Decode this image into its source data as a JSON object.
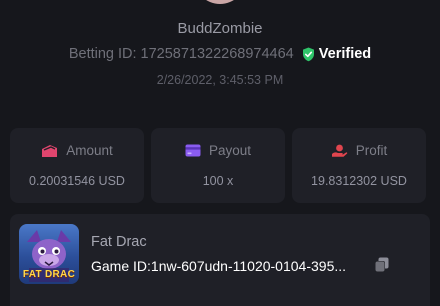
{
  "profile": {
    "username": "BuddZombie"
  },
  "bet": {
    "id_label": "Betting ID:",
    "id_value": "1725871322268974464",
    "verified_label": "Verified",
    "timestamp": "2/26/2022, 3:45:53 PM"
  },
  "stats": [
    {
      "label": "Amount",
      "value": "0.20031546 USD",
      "icon": "ticket-icon",
      "color": "#e0456e"
    },
    {
      "label": "Payout",
      "value": "100 x",
      "icon": "credit-card-icon",
      "color": "#8a5cf0"
    },
    {
      "label": "Profit",
      "value": "19.8312302 USD",
      "icon": "hand-coins-icon",
      "color": "#e0454e"
    }
  ],
  "game": {
    "name": "Fat Drac",
    "thumbnail_text": "FAT DRAC",
    "id_label": "Game ID:",
    "id_value": "1nw-607udn-11020-0104-395..."
  },
  "colors": {
    "verified_shield": "#2fc46a",
    "background": "#16171c",
    "card": "#1f2027"
  }
}
